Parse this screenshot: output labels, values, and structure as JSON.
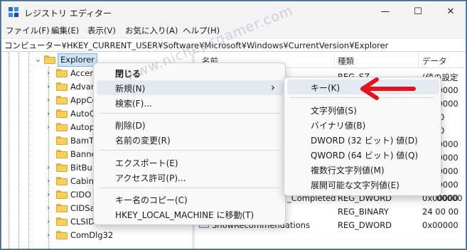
{
  "window": {
    "title": "レジストリ エディター"
  },
  "caption": {
    "minimize": "—",
    "maximize": "☐",
    "close": "✕"
  },
  "menubar": [
    "ファイル(F)",
    "編集(E)",
    "表示(V)",
    "お気に入り(A)",
    "ヘルプ(H)"
  ],
  "address": "コンピューター¥HKEY_CURRENT_USER¥Software¥Microsoft¥Windows¥CurrentVersion¥Explorer",
  "tree": {
    "selected": "Explorer",
    "children": [
      "Accen",
      "Advan",
      "AppCo",
      "AutoC",
      "Autop",
      "BamT",
      "Banne",
      "BitBu",
      "Cabin",
      "CIDO",
      "CIDSa",
      "CLSID",
      "ComDlg32"
    ]
  },
  "list": {
    "headers": {
      "name": "名前",
      "type": "種類",
      "data": "データ"
    },
    "rows": [
      {
        "name": "",
        "type": "REG_SZ",
        "data": "(値の設定"
      },
      {
        "name": "",
        "type": "",
        "data": "0x00000"
      },
      {
        "name": "",
        "type": "",
        "data": "0x00000"
      },
      {
        "name": "",
        "type": "",
        "data": "0"
      },
      {
        "name": "",
        "type": "",
        "data": "0"
      },
      {
        "name": "",
        "type": "",
        "data": "0x00000"
      },
      {
        "name": "",
        "type": "",
        "data": "0x00000"
      },
      {
        "name": "",
        "type": "",
        "data": "0x00000"
      },
      {
        "name": "",
        "type": "",
        "data": "0x00000"
      },
      {
        "name": "",
        "type": "",
        "data": "00000"
      },
      {
        "name": "_Completed",
        "type": "REG_DWORD",
        "data": "0x00000"
      },
      {
        "name": "",
        "type": "REG_BINARY",
        "data": "24 00 00"
      },
      {
        "name": "ShowRecommendations",
        "type": "REG_DWORD",
        "data": "0x00000"
      }
    ]
  },
  "context_menu": {
    "items": {
      "collapse": "閉じる",
      "new": "新規(N)",
      "find": "検索(F)...",
      "delete": "削除(D)",
      "rename": "名前の変更(R)",
      "export": "エクスポート(E)",
      "permissions": "アクセス許可(P)...",
      "copy_key_name": "キー名のコピー(C)",
      "goto_hklm": "HKEY_LOCAL_MACHINE に移動(T)"
    },
    "submenu_arrow": "›"
  },
  "submenu": {
    "key": "キー(K)",
    "string": "文字列値(S)",
    "binary": "バイナリ値(B)",
    "dword": "DWORD (32 ビット) 値(D)",
    "qword": "QWORD (64 ビット) 値(Q)",
    "multi_string": "複数行文字列値(M)",
    "expandable_string": "展開可能な文字列値(E)"
  },
  "watermark": "www.nichepcgamer.com",
  "colors": {
    "accent_arrow": "#e0141e",
    "selection": "#cce4f7",
    "folder": "#f7cf5a"
  }
}
